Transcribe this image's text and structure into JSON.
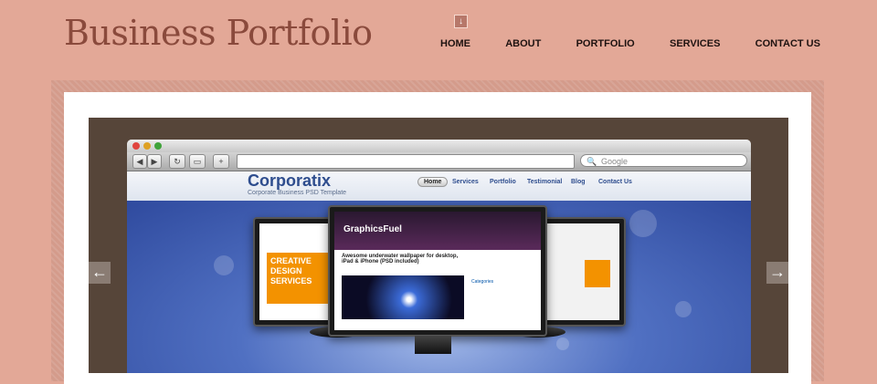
{
  "header": {
    "logo": "Business Portfolio",
    "nav_marker_icon": "arrow-down-icon",
    "nav": [
      "HOME",
      "ABOUT",
      "PORTFOLIO",
      "SERVICES",
      "CONTACT US"
    ]
  },
  "slider": {
    "prev_icon": "arrow-left-icon",
    "next_icon": "arrow-right-icon",
    "prev_glyph": "←",
    "next_glyph": "→"
  },
  "browser": {
    "nav_back": "◀",
    "nav_fwd": "▶",
    "reload": "↻",
    "add": "+",
    "search_placeholder": "Google",
    "search_icon": "🔍"
  },
  "preview_site": {
    "brand": "Corporatix",
    "tagline": "Corporate Business PSD Template",
    "nav": [
      "Home",
      "Services",
      "Portfolio",
      "Testimonial",
      "Blog",
      "Contact Us"
    ]
  },
  "monitors": {
    "left_title": "CREATIVE DESIGN SERVICES",
    "center_logo": "GraphicsFuel",
    "center_headline": "Awesome underwater wallpaper for desktop, iPad & iPhone (PSD included)",
    "center_sidebar": "Categories"
  },
  "colors": {
    "background": "#e3a897",
    "logo": "#8a4a3c",
    "nav_text": "#1e1210",
    "slide_bg": "#564539",
    "arrow_bg": "#8a7c73"
  }
}
